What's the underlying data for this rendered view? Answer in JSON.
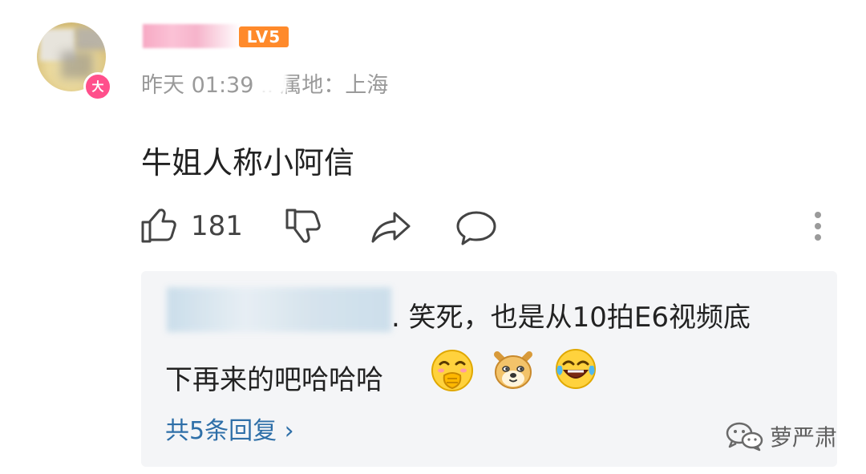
{
  "comment": {
    "avatar_badge": "大",
    "level_badge": "LV5",
    "meta": "昨天 01:39 IP属地：上海",
    "text": "牛姐人称小阿信",
    "like_count": "181"
  },
  "reply": {
    "line1": ". 笑死，也是从10拍E6视频底",
    "line2": "下再来的吧哈哈哈",
    "emojis": [
      "cover-face-laugh-icon",
      "doge-icon",
      "tears-of-joy-icon"
    ],
    "view_replies": "共5条回复 ›"
  },
  "watermark": {
    "text": "萝严肃"
  },
  "colors": {
    "badge_pink": "#ff4f8b",
    "level_orange": "#ff8a2b",
    "link_blue": "#2e6fa8",
    "meta_gray": "#9a9a9a",
    "reply_bg": "#f4f5f7"
  }
}
